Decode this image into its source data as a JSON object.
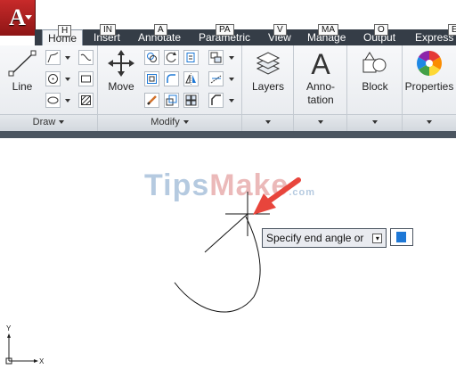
{
  "titlebar": {
    "app_letter": "A"
  },
  "tabs": [
    {
      "label": "Home",
      "keytip": "H"
    },
    {
      "label": "Insert",
      "keytip": "IN"
    },
    {
      "label": "Annotate",
      "keytip": "A"
    },
    {
      "label": "Parametric",
      "keytip": "PA"
    },
    {
      "label": "View",
      "keytip": "V"
    },
    {
      "label": "Manage",
      "keytip": "MA"
    },
    {
      "label": "Output",
      "keytip": "O"
    },
    {
      "label": "Express",
      "keytip": "E"
    }
  ],
  "ribbon": {
    "draw": {
      "line_label": "Line",
      "panel_label": "Draw"
    },
    "modify": {
      "move_label": "Move",
      "panel_label": "Modify"
    },
    "layers": {
      "label": "Layers"
    },
    "annotation": {
      "label_line1": "Anno-",
      "label_line2": "tation"
    },
    "block": {
      "label": "Block"
    },
    "properties": {
      "label": "Properties"
    }
  },
  "canvas": {
    "watermark_part1": "Tips",
    "watermark_part2": "Make",
    "watermark_suffix": ".com",
    "prompt_text": "Specify end angle or",
    "ucs_y": "Y",
    "ucs_x": "X"
  },
  "colors": {
    "app_red": "#c72a2a",
    "tab_bar": "#353d47",
    "input_cursor": "#1e78d6",
    "arrow": "#e8453c"
  }
}
